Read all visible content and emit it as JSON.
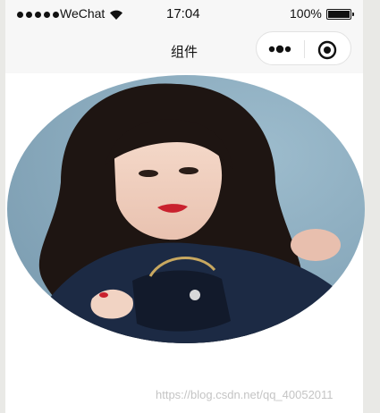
{
  "status_bar": {
    "carrier": "WeChat",
    "time": "17:04",
    "battery": "100%"
  },
  "nav": {
    "title": "组件"
  },
  "image": {
    "shape": "ellipse",
    "colors": {
      "background": "#8fb0c3",
      "hair": "#1e1512",
      "jacket": "#1c2a44",
      "skin": "#f1d3c3"
    }
  },
  "watermark": "https://blog.csdn.net/qq_40052011"
}
